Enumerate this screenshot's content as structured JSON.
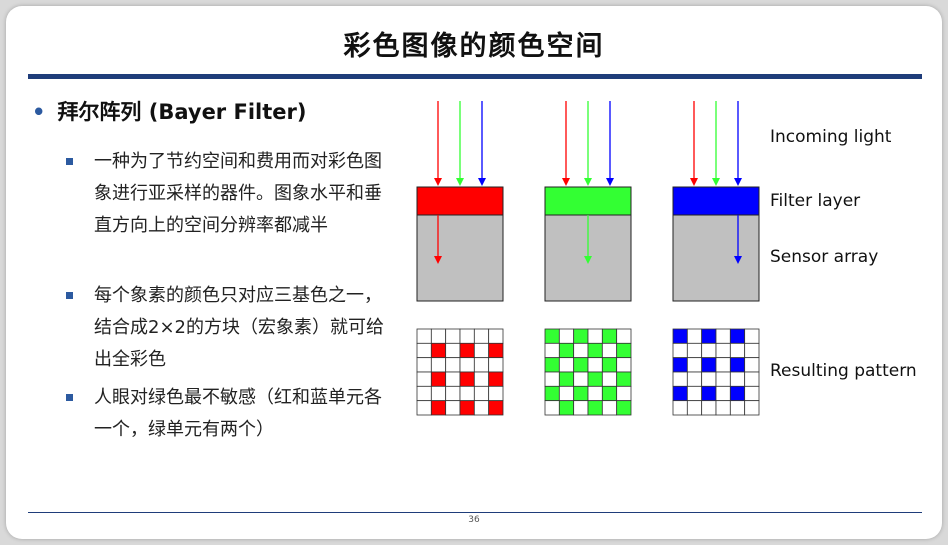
{
  "slide": {
    "title": "彩色图像的颜色空间",
    "main_bullet": "拜尔阵列 (Bayer Filter)",
    "sub_bullets": [
      "一种为了节约空间和费用而对彩色图象进行亚采样的器件。图象水平和垂直方向上的空间分辨率都减半",
      "每个象素的颜色只对应三基色之一，结合成2×2的方块（宏象素）就可给出全彩色",
      "人眼对绿色最不敏感（红和蓝单元各一个，绿单元有两个）"
    ],
    "page_number": "36"
  },
  "diagram": {
    "labels": {
      "incoming": "Incoming light",
      "filter": "Filter layer",
      "sensor": "Sensor array",
      "pattern": "Resulting pattern"
    },
    "columns": [
      {
        "channel": "red",
        "color": "#ff0000"
      },
      {
        "channel": "green",
        "color": "#33ff33"
      },
      {
        "channel": "blue",
        "color": "#0000ff"
      }
    ],
    "light_colors": [
      "#ff0000",
      "#33ff33",
      "#0000ff"
    ],
    "sensor_color": "#c0c0c0",
    "grid": {
      "rows": 6,
      "cols": 6
    }
  },
  "colors": {
    "accent": "#1f3d7a",
    "bullet": "#2c5aa0"
  }
}
